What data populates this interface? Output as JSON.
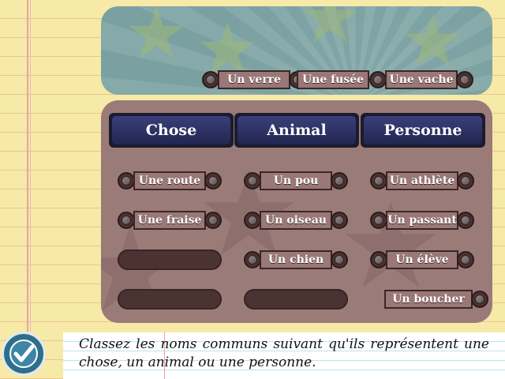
{
  "bank": {
    "items": [
      "Un verre",
      "Une fusée",
      "Une vache"
    ]
  },
  "columns": [
    {
      "header": "Chose",
      "items": [
        "Une route",
        "Une fraise"
      ],
      "empty_slots": 2
    },
    {
      "header": "Animal",
      "items": [
        "Un pou",
        "Un oiseau",
        "Un chien"
      ],
      "empty_slots": 1
    },
    {
      "header": "Personne",
      "items": [
        "Un athlète",
        "Un passant",
        "Un élève",
        "Un boucher"
      ],
      "empty_slots": 0
    }
  ],
  "instruction": "Classez les noms communs suivant qu'ils représentent une chose, un animal ou une personne.",
  "colors": {
    "board": "#9b7b78",
    "header": "#22264f",
    "chip": "#9a7878",
    "bank": "#7aa0a2"
  },
  "icons": {
    "validate": "check-icon"
  }
}
